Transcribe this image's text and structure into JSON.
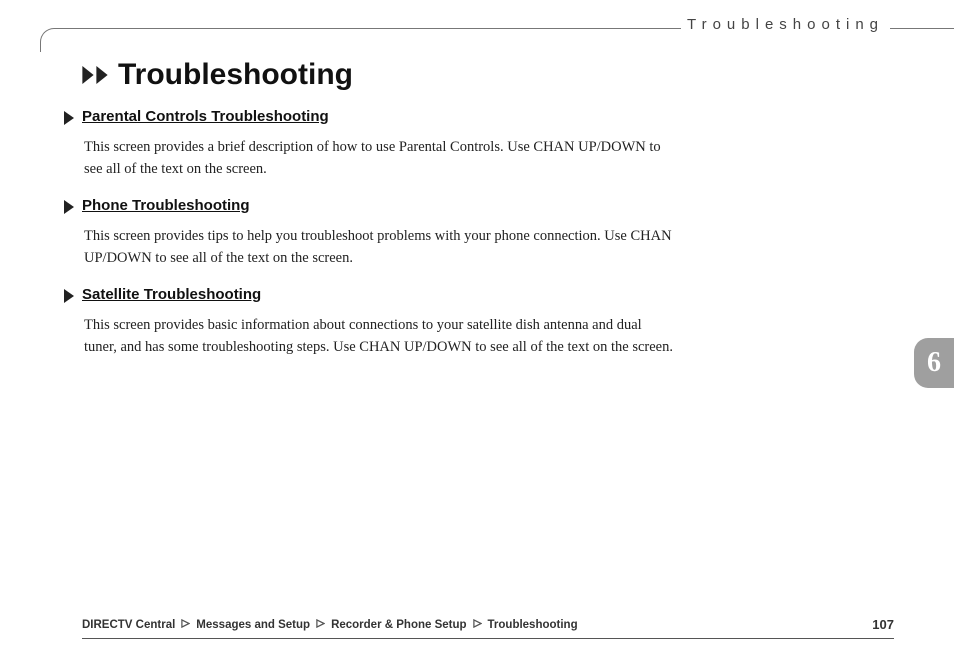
{
  "header": {
    "label": "Troubleshooting"
  },
  "title": "Troubleshooting",
  "chapter": "6",
  "sections": [
    {
      "title": "Parental Controls Troubleshooting",
      "body": "This screen provides a brief description of how to use Parental Controls. Use CHAN UP/DOWN to see all of the text on the screen."
    },
    {
      "title": "Phone Troubleshooting",
      "body": "This screen provides tips to help you troubleshoot problems with your phone connection. Use CHAN UP/DOWN to see all of the text on the screen."
    },
    {
      "title": "Satellite Troubleshooting",
      "body": "This screen provides basic information about connections to your satellite dish antenna and dual tuner, and has some troubleshooting steps. Use CHAN UP/DOWN to see all of the text on the screen."
    }
  ],
  "breadcrumbs": [
    "DIRECTV Central",
    "Messages and Setup",
    "Recorder & Phone Setup",
    "Troubleshooting"
  ],
  "page_number": "107"
}
